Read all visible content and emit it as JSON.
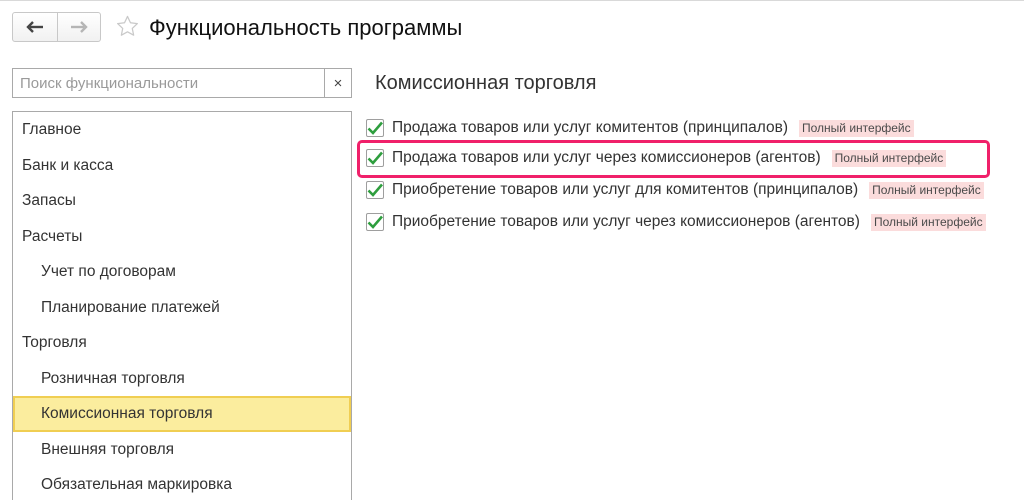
{
  "header": {
    "title": "Функциональность программы",
    "back_icon": "arrow-left-icon",
    "forward_icon": "arrow-right-icon",
    "favorite_icon": "star-outline-icon"
  },
  "search": {
    "placeholder": "Поиск функциональности",
    "value": "",
    "clear_label": "×"
  },
  "sidebar": {
    "items": [
      {
        "label": "Главное"
      },
      {
        "label": "Банк и касса"
      },
      {
        "label": "Запасы"
      },
      {
        "label": "Расчеты"
      },
      {
        "label": "Учет по договорам"
      },
      {
        "label": "Планирование платежей"
      },
      {
        "label": "Торговля"
      },
      {
        "label": "Розничная торговля"
      },
      {
        "label": "Комиссионная торговля"
      },
      {
        "label": "Внешняя торговля"
      },
      {
        "label": "Обязательная маркировка"
      }
    ]
  },
  "content": {
    "title": "Комиссионная торговля",
    "options": [
      {
        "label": "Продажа товаров или услуг комитентов (принципалов)",
        "badge": "Полный интерфейс",
        "checked": true
      },
      {
        "label": "Продажа товаров или услуг через комиссионеров (агентов)",
        "badge": "Полный интерфейс",
        "checked": true
      },
      {
        "label": "Приобретение товаров или услуг для комитентов (принципалов)",
        "badge": "Полный интерфейс",
        "checked": true
      },
      {
        "label": "Приобретение товаров или услуг через комиссионеров (агентов)",
        "badge": "Полный интерфейс",
        "checked": true
      }
    ]
  },
  "colors": {
    "accent_highlight": "#f0206a",
    "selected_item_bg": "#fbed9e",
    "selected_item_border": "#f0ce52",
    "checkmark": "#2e9e3e",
    "badge_bg": "#fbdcdc"
  }
}
